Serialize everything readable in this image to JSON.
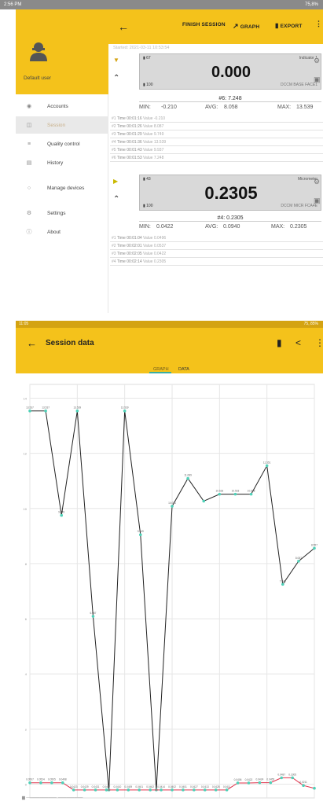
{
  "screen1": {
    "status_left": "2:56 PM",
    "status_right": "75,8%",
    "appbar": {
      "finish_session": "FINISH SESSION",
      "graph": "GRAPH",
      "export": "EXPORT"
    },
    "drawer": {
      "user": "Default user",
      "items": [
        {
          "label": "Accounts",
          "icon": "account-icon"
        },
        {
          "label": "Session",
          "icon": "session-icon"
        },
        {
          "label": "Quality control",
          "icon": "quality-icon"
        },
        {
          "label": "History",
          "icon": "history-icon"
        },
        {
          "label": "Manage devices",
          "icon": "devices-icon"
        },
        {
          "label": "Settings",
          "icon": "settings-icon"
        },
        {
          "label": "About",
          "icon": "about-icon"
        }
      ]
    },
    "started": "Started: 2021-03-11 10:53:54",
    "device1": {
      "reading": "0.000",
      "tl": "▮ 67",
      "tr": "Indicator 1",
      "bl": "▮ 100",
      "br": "DCCM BASE FACE1",
      "last": "#6: 7.248",
      "min_label": "MIN:",
      "min": "-0.210",
      "avg_label": "AVG:",
      "avg": "8.058",
      "max_label": "MAX:",
      "max": "13.539",
      "rows": [
        {
          "n": "#1",
          "time": "Time 00:01:16",
          "value": "Value -0.210"
        },
        {
          "n": "#2",
          "time": "Time 00:01:26",
          "value": "Value 8.087"
        },
        {
          "n": "#3",
          "time": "Time 00:01:29",
          "value": "Value 9.749"
        },
        {
          "n": "#4",
          "time": "Time 00:01:36",
          "value": "Value 13.539"
        },
        {
          "n": "#5",
          "time": "Time 00:01:43",
          "value": "Value 9.937"
        },
        {
          "n": "#6",
          "time": "Time 00:01:53",
          "value": "Value 7.248"
        }
      ]
    },
    "device2": {
      "reading": "0.2305",
      "tl": "▮ 43",
      "tr": "Micrometer",
      "bl": "▮ 100",
      "br": "DCCM MICR FCA4E",
      "last": "#4: 0.2305",
      "min_label": "MIN:",
      "min": "0.0422",
      "avg_label": "AVG:",
      "avg": "0.0940",
      "max_label": "MAX:",
      "max": "0.2305",
      "rows": [
        {
          "n": "#1",
          "time": "Time 00:01:04",
          "value": "Value 0.0496"
        },
        {
          "n": "#2",
          "time": "Time 00:02:01",
          "value": "Value 0.0537"
        },
        {
          "n": "#3",
          "time": "Time 00:02:05",
          "value": "Value 0.0422"
        },
        {
          "n": "#4",
          "time": "Time 00:02:14",
          "value": "Value 0.2305"
        }
      ]
    }
  },
  "screen2": {
    "status_left": "11:05",
    "status_right": "75, 85%",
    "title": "Session data",
    "tab_graph": "GRAPH",
    "tab_data": "DATA",
    "footer": "▆  ─────────── ─────────"
  },
  "chart_data": {
    "type": "line",
    "ylim": [
      -0.5,
      14.5
    ],
    "y_ticks": [
      0,
      2,
      4,
      6,
      8,
      10,
      12,
      14
    ],
    "grid": true,
    "x": [
      0,
      1,
      2,
      3,
      4,
      5,
      6,
      7,
      8,
      9,
      10,
      11,
      12,
      13,
      14,
      15,
      16,
      17,
      18,
      19,
      20,
      21,
      22,
      23,
      24,
      25,
      26,
      27,
      28,
      29
    ],
    "series": [
      {
        "color": "#222222",
        "point_color": "#4fd1b8",
        "values": [
          13.539,
          13.539,
          9.749,
          13.539,
          6.087,
          -0.21,
          13.539,
          9.047,
          -0.21,
          10.081,
          11.089,
          10.267,
          10.518,
          10.518,
          10.518,
          11.551,
          7.248,
          8.087,
          8.557
        ],
        "labels": [
          "13.537",
          "13.537",
          "9.749",
          "13.539",
          "6.087",
          "",
          "13.539",
          "9.049",
          "",
          "10.081",
          "11.089",
          "",
          "10.518",
          "10.518",
          "10.518",
          "11.551",
          "7.248",
          "8.087",
          "8.557"
        ]
      },
      {
        "color": "#e0304a",
        "point_color": "#4fd1b8",
        "values": [
          0.0496,
          0.0496,
          0.0496,
          0.0496,
          -0.21,
          -0.21,
          -0.21,
          -0.21,
          -0.21,
          -0.21,
          -0.21,
          -0.21,
          -0.21,
          -0.21,
          -0.21,
          -0.21,
          -0.21,
          -0.21,
          -0.21,
          0.0422,
          0.0422,
          0.0537,
          0.0537,
          0.2305,
          0.2305,
          -0.05,
          -0.15
        ],
        "labels": [
          "0.0507",
          "0.0524",
          "0.0505",
          "0.0498",
          "0.0423",
          "0.0429",
          "0.0431",
          "0.0407",
          "0.0410",
          "0.0409",
          "0.0401",
          "0.0402",
          "0.0414",
          "0.0402",
          "0.0401",
          "0.0427",
          "0.0413",
          "0.0428",
          "0.0411",
          "0.0406",
          "0.0422",
          "0.0424",
          "0.0455",
          "0.0487",
          "0.2305",
          "0.0211",
          ""
        ]
      }
    ]
  }
}
